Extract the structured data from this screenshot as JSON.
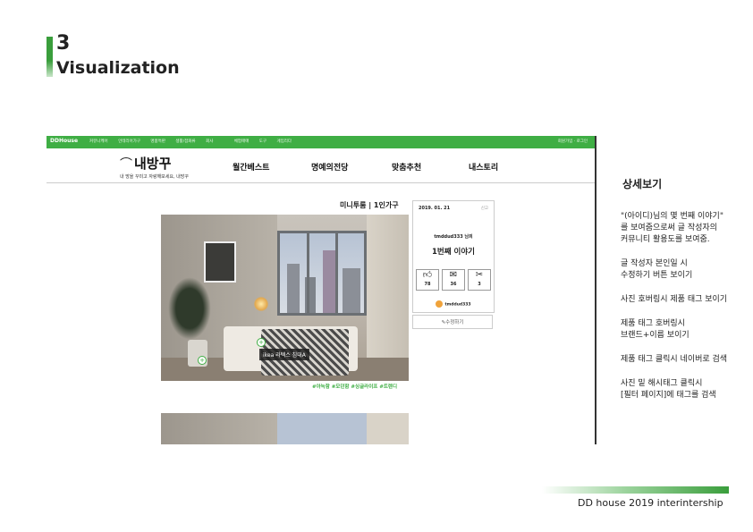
{
  "slide": {
    "number": "3",
    "title": "Visualization",
    "footer": "DD house 2019 interintership"
  },
  "mockup": {
    "topbar": {
      "logo": "DDHouse",
      "nav": [
        "커뮤니케어",
        "인테리어가구",
        "명품특판",
        "생활/잡화류",
        "회사",
        "체험매매",
        "도구",
        "게임리다"
      ],
      "right": "회원가입 · 로그인"
    },
    "brand": {
      "name": "내방꾸",
      "tagline": "내 방을 꾸미고 자랑해보세요, 내방꾸"
    },
    "main_nav": [
      "월간베스트",
      "명예의전당",
      "맞춤추천",
      "내스토리"
    ],
    "category": "미니투룸 | 1인가구",
    "photo": {
      "product_tag": "ikea 라텍스 침대A",
      "hashtags": "#아늑함 #모던함 #싱글라이프 #트렌디"
    },
    "card": {
      "date": "2019. 01. 21",
      "report": "신고",
      "user_line": "tmddud333 님의",
      "story_title": "1번째 이야기",
      "stats": [
        {
          "icon": "thumbs-up-icon",
          "value": "78"
        },
        {
          "icon": "comment-icon",
          "value": "36"
        },
        {
          "icon": "scissors-icon",
          "value": "3"
        }
      ],
      "writer": "tmddud333",
      "edit_label": "수정하기"
    }
  },
  "notes": {
    "title": "상세보기",
    "items": [
      "\"(아이디)님의 몇 번째 이야기\"\n를 보여줌으로써 글 작성자의\n커뮤니티 활용도를 보여줌.",
      "글 작성자 본인일 시\n수정하기 버튼 보이기",
      "사진 호버링시 제품 태그 보이기",
      "제품 태그 호버링시\n브랜드+이름 보이기",
      "제품 태그 클릭시 네이버로 검색",
      "사진 밑 해시태그 클릭시\n[필터 페이지]에 태그를 검색"
    ]
  }
}
